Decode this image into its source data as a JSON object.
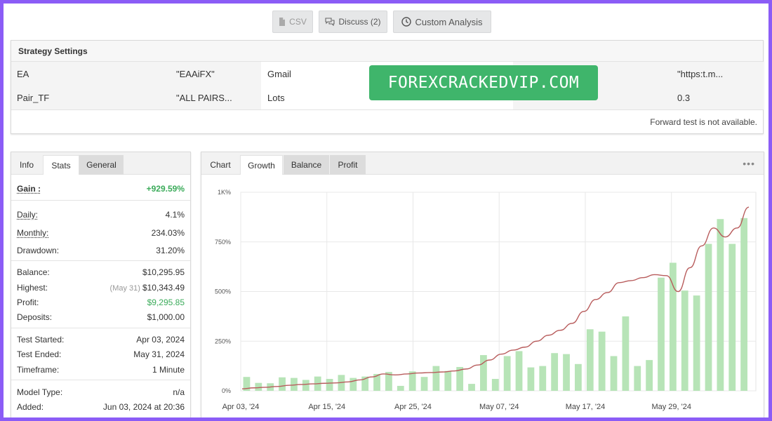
{
  "toolbar": {
    "csv_label": "CSV",
    "discuss_label": "Discuss (2)",
    "custom_label": "Custom Analysis"
  },
  "settings": {
    "title": "Strategy Settings",
    "rows": [
      {
        "k1": "EA",
        "v1": "\"EAAiFX\"",
        "k2": "Gmail",
        "v3": "\"https:t.m..."
      },
      {
        "k1": "Pair_TF",
        "v1": "\"ALL PAIRS...",
        "k2": "Lots",
        "v3": "0.3"
      }
    ],
    "footer": "Forward test is not available."
  },
  "watermark": "FOREXCRACKEDVIP.COM",
  "info": {
    "tabs": [
      "Info",
      "Stats",
      "General"
    ],
    "gain_label": "Gain :",
    "gain_value": "+929.59%",
    "daily_label": "Daily:",
    "daily_value": "4.1%",
    "monthly_label": "Monthly:",
    "monthly_value": "234.03%",
    "drawdown_label": "Drawdown:",
    "drawdown_value": "31.20%",
    "balance_label": "Balance:",
    "balance_value": "$10,295.95",
    "highest_label": "Highest:",
    "highest_note": "(May 31)",
    "highest_value": "$10,343.49",
    "profit_label": "Profit:",
    "profit_value": "$9,295.85",
    "deposits_label": "Deposits:",
    "deposits_value": "$1,000.00",
    "started_label": "Test Started:",
    "started_value": "Apr 03, 2024",
    "ended_label": "Test Ended:",
    "ended_value": "May 31, 2024",
    "timeframe_label": "Timeframe:",
    "timeframe_value": "1 Minute",
    "model_label": "Model Type:",
    "model_value": "n/a",
    "added_label": "Added:",
    "added_value": "Jun 03, 2024 at 20:36"
  },
  "chart": {
    "tabs": [
      "Chart",
      "Growth",
      "Balance",
      "Profit"
    ],
    "menu": "•••"
  },
  "colors": {
    "bar": "#b7e4b7",
    "line": "#b85c5c",
    "green": "#3bab5a"
  },
  "chart_data": {
    "type": "bar",
    "y_ticks": [
      "0%",
      "250%",
      "500%",
      "750%",
      "1K%"
    ],
    "ylim": [
      0,
      1000
    ],
    "x_ticks": [
      "Apr 03, '24",
      "Apr 15, '24",
      "Apr 25, '24",
      "May 07, '24",
      "May 17, '24",
      "May 29, '24"
    ],
    "grid": true,
    "series": [
      {
        "type": "bar",
        "values": [
          70,
          40,
          38,
          68,
          65,
          55,
          72,
          60,
          80,
          65,
          72,
          85,
          95,
          25,
          98,
          70,
          125,
          100,
          120,
          35,
          180,
          60,
          175,
          200,
          118,
          125,
          190,
          185,
          135,
          310,
          298,
          175,
          375,
          125,
          155,
          570,
          645,
          505,
          480,
          740,
          865,
          740,
          870
        ]
      },
      {
        "type": "line",
        "values": [
          10,
          15,
          18,
          22,
          28,
          32,
          35,
          38,
          40,
          45,
          55,
          70,
          85,
          80,
          85,
          90,
          92,
          95,
          100,
          110,
          130,
          155,
          185,
          205,
          220,
          250,
          280,
          305,
          340,
          400,
          460,
          495,
          545,
          555,
          570,
          585,
          580,
          500,
          620,
          730,
          820,
          775,
          820,
          925
        ]
      }
    ]
  }
}
